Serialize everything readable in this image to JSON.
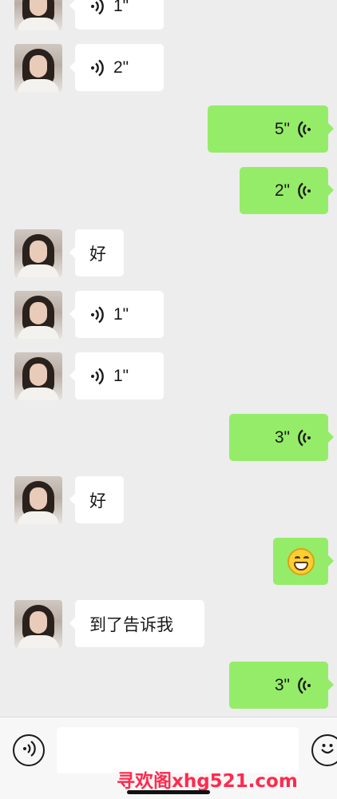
{
  "messages": [
    {
      "side": "left",
      "kind": "voice",
      "duration": "1\""
    },
    {
      "side": "left",
      "kind": "voice",
      "duration": "2\""
    },
    {
      "side": "right",
      "kind": "voice",
      "duration": "5\""
    },
    {
      "side": "right",
      "kind": "voice",
      "duration": "2\""
    },
    {
      "side": "left",
      "kind": "text",
      "text": "好"
    },
    {
      "side": "left",
      "kind": "voice",
      "duration": "1\""
    },
    {
      "side": "left",
      "kind": "voice",
      "duration": "1\""
    },
    {
      "side": "right",
      "kind": "voice",
      "duration": "3\""
    },
    {
      "side": "left",
      "kind": "text",
      "text": "好"
    },
    {
      "side": "right",
      "kind": "emoji",
      "emoji": "grinning-face"
    },
    {
      "side": "left",
      "kind": "text",
      "text": "到了告诉我"
    },
    {
      "side": "right",
      "kind": "voice",
      "duration": "3\""
    }
  ],
  "input_bar": {
    "voice_button_icon": "voice-icon",
    "text_input_value": "",
    "emoji_button_icon": "smiley-icon"
  },
  "watermark": "寻欢阁xhg521.com",
  "colors": {
    "background": "#ededed",
    "sent_bubble": "#95ec69",
    "received_bubble": "#ffffff",
    "watermark": "#ff2a4d"
  }
}
